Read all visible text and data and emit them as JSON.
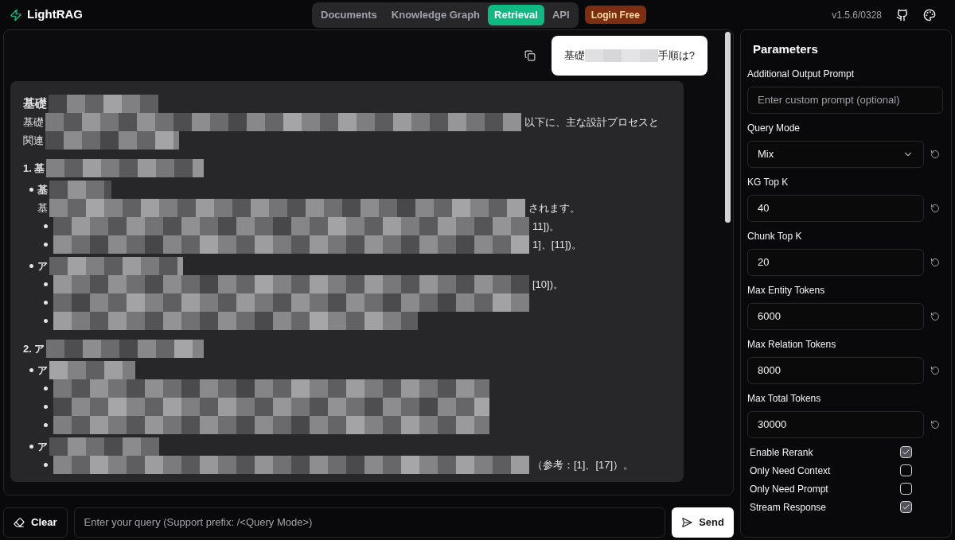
{
  "header": {
    "logo": "LightRAG",
    "tabs": [
      {
        "label": "Documents",
        "selected": false
      },
      {
        "label": "Knowledge Graph",
        "selected": false
      },
      {
        "label": "Retrieval",
        "selected": true
      },
      {
        "label": "API",
        "selected": false
      }
    ],
    "badge": "Login Free",
    "version": "v1.5.6/0328"
  },
  "question": {
    "prefix": "基礎",
    "suffix": "手順は?"
  },
  "answer": {
    "lines": [
      {
        "kind": "title",
        "text": "基礎"
      },
      {
        "kind": "paragraph",
        "text": "基礎",
        "suffix": "以下に、主な設計プロセスと"
      },
      {
        "kind": "paragraph",
        "text": "関連"
      },
      {
        "kind": "heading",
        "text": "1. 基"
      },
      {
        "kind": "bullet",
        "text": "基"
      },
      {
        "kind": "indent",
        "text": "基",
        "suffix": "されます。"
      },
      {
        "kind": "subbullet",
        "suffix": "11])。"
      },
      {
        "kind": "subbullet",
        "suffix": "1]、[11])。"
      },
      {
        "kind": "bullet",
        "text": "ア"
      },
      {
        "kind": "subbullet",
        "suffix": "[10])。"
      },
      {
        "kind": "subbullet"
      },
      {
        "kind": "subbullet"
      },
      {
        "kind": "heading",
        "text": "2. ア"
      },
      {
        "kind": "bullet",
        "text": "ア"
      },
      {
        "kind": "subbullet"
      },
      {
        "kind": "subbullet"
      },
      {
        "kind": "subbullet"
      },
      {
        "kind": "bullet",
        "text": "ア"
      },
      {
        "kind": "subbullet",
        "suffix": "（参考：[1]、[17]）。"
      }
    ]
  },
  "input": {
    "clear": "Clear",
    "placeholder": "Enter your query (Support prefix: /<Query Mode>)",
    "send": "Send"
  },
  "parameters": {
    "title": "Parameters",
    "fields": [
      {
        "kind": "text",
        "label": "Additional Output Prompt",
        "placeholder": "Enter custom prompt (optional)"
      },
      {
        "kind": "select",
        "label": "Query Mode",
        "value": "Mix"
      },
      {
        "kind": "number",
        "label": "KG Top K",
        "value": "40"
      },
      {
        "kind": "number",
        "label": "Chunk Top K",
        "value": "20"
      },
      {
        "kind": "number",
        "label": "Max Entity Tokens",
        "value": "6000"
      },
      {
        "kind": "number",
        "label": "Max Relation Tokens",
        "value": "8000"
      },
      {
        "kind": "number",
        "label": "Max Total Tokens",
        "value": "30000"
      }
    ],
    "checks": [
      {
        "label": "Enable Rerank",
        "checked": true
      },
      {
        "label": "Only Need Context",
        "checked": false
      },
      {
        "label": "Only Need Prompt",
        "checked": false
      },
      {
        "label": "Stream Response",
        "checked": true
      }
    ]
  }
}
